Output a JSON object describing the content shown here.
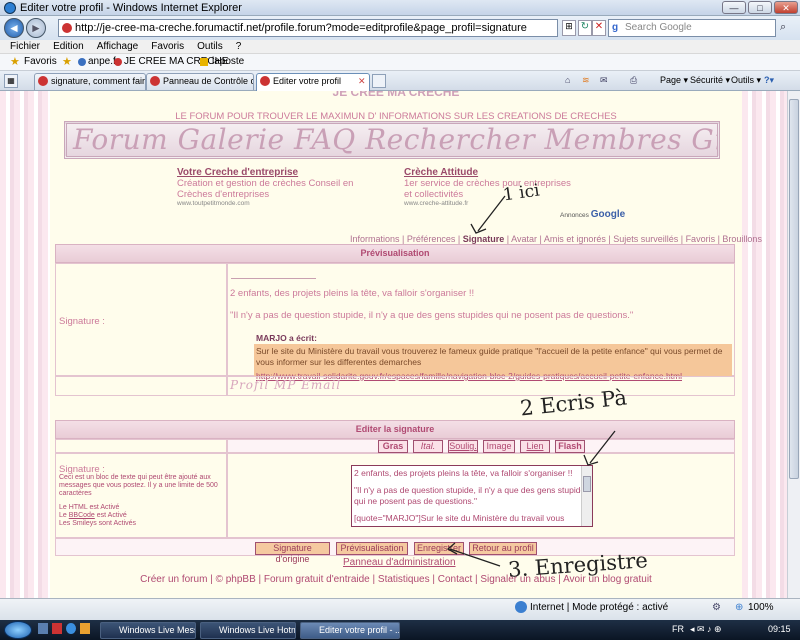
{
  "window": {
    "title": "Editer votre profil - Windows Internet Explorer",
    "min": "—",
    "max": "□",
    "close": "✕"
  },
  "address": {
    "url": "http://je-cree-ma-creche.forumactif.net/profile.forum?mode=editprofile&page_profil=signature",
    "search_placeholder": "Search Google"
  },
  "menu": [
    "Fichier",
    "Edition",
    "Affichage",
    "Favoris",
    "Outils",
    "?"
  ],
  "favbar": {
    "favoris": "Favoris",
    "links": [
      "anpe.fr",
      "JE CREE MA CRECHE",
      "laposte"
    ]
  },
  "tabs": [
    "signature, comment faire ?",
    "Panneau de Contrôle des ...",
    "Editer votre profil"
  ],
  "toolbar_right": {
    "page": "Page",
    "securite": "Sécurité",
    "outils": "Outils"
  },
  "site": {
    "title": "JE CREE MA CRECHE",
    "subtitle": "LE FORUM POUR TROUVER LE MAXIMUN D' INFORMATIONS SUR LES CREATIONS DE CRECHES",
    "nav_banner": "Forum Galerie FAQ Rechercher Membres Groupes Profil Messages Off"
  },
  "ads": [
    {
      "title": "Votre Creche d'entreprise",
      "text": "Création et gestion de crèches Conseil en Crèches d'entreprises",
      "url": "www.toutpetitmonde.com"
    },
    {
      "title": "Crèche Attitude",
      "text": "1er service de crèches pour entreprises et collectivités",
      "url": "www.creche-attitude.fr"
    }
  ],
  "annonces": "Annonces",
  "google": "Google",
  "profile_nav": {
    "items": [
      "Informations",
      "Préférences",
      "Signature",
      "Avatar",
      "Amis et ignorés",
      "Sujets surveillés",
      "Favoris",
      "Brouillons"
    ],
    "separator": " | "
  },
  "preview": {
    "header": "Prévisualisation",
    "label": "Signature :",
    "line1": "2 enfants, des projets pleins la tête, va falloir s'organiser !!",
    "line2": "\"Il n'y a pas de question stupide, il n'y a que des gens stupides qui ne posent pas de questions.\"",
    "quote_author": "MARJO a écrit:",
    "quote_text": "Sur le site du Ministère du travail vous trouverez le fameux guide pratique \"l'accueil de la petite enfance\" qui vous permet de vous informer sur les differentes demarches",
    "quote_link": "http://www.travail-solidarite.gouv.fr/espaces/famille/navigation-bloc-2/guides-pratiques/accueil-petite-enfance.html",
    "profil_buttons": "Profil MP Email"
  },
  "edit": {
    "header": "Editer la signature",
    "format_buttons": [
      "Gras",
      "Ital.",
      "Soulig.",
      "Image",
      "Lien",
      "Flash"
    ],
    "label": "Signature :",
    "help": "Ceci est un bloc de texte qui peut être ajouté aux messages que vous postez. Il y a une limite de 500 caractères",
    "html_status": "Le HTML est Activé",
    "bbcode_prefix": "Le ",
    "bbcode_link": "BBCode",
    "bbcode_suffix": " est Activé",
    "smileys": "Les Smileys sont Activés",
    "textarea_lines": [
      "2 enfants, des projets pleins la tête, va falloir s'organiser !!",
      "",
      "\"Il n'y a pas de question stupide, il n'y a que des gens stupides qui ne posent pas de questions.\"",
      "",
      "[quote=\"MARJO\"]Sur le site du Ministère du travail vous trouverez le fameux guide pratique \"l'accueil de la petite"
    ],
    "action_buttons": [
      "Signature d'origine",
      "Prévisualisation",
      "Enregistrer",
      "Retour au profil"
    ],
    "admin_link": "Panneau d'administration"
  },
  "footer": {
    "items": [
      "Créer un forum",
      "© phpBB",
      "Forum gratuit d'entraide",
      "Statistiques",
      "Contact",
      "Signaler un abus",
      "Avoir un blog gratuit"
    ],
    "separator": " | "
  },
  "annotations": {
    "a1": "1  ici",
    "a2": "2  Ecris Pà",
    "a3": "3. Enregistre"
  },
  "status": {
    "zone": "Internet | Mode protégé : activé",
    "zoom": "100%"
  },
  "taskbar": {
    "items": [
      "Windows Live Mess...",
      "Windows Live Hotm...",
      "Editer votre profil - ..."
    ],
    "lang": "FR",
    "time": "09:15"
  }
}
